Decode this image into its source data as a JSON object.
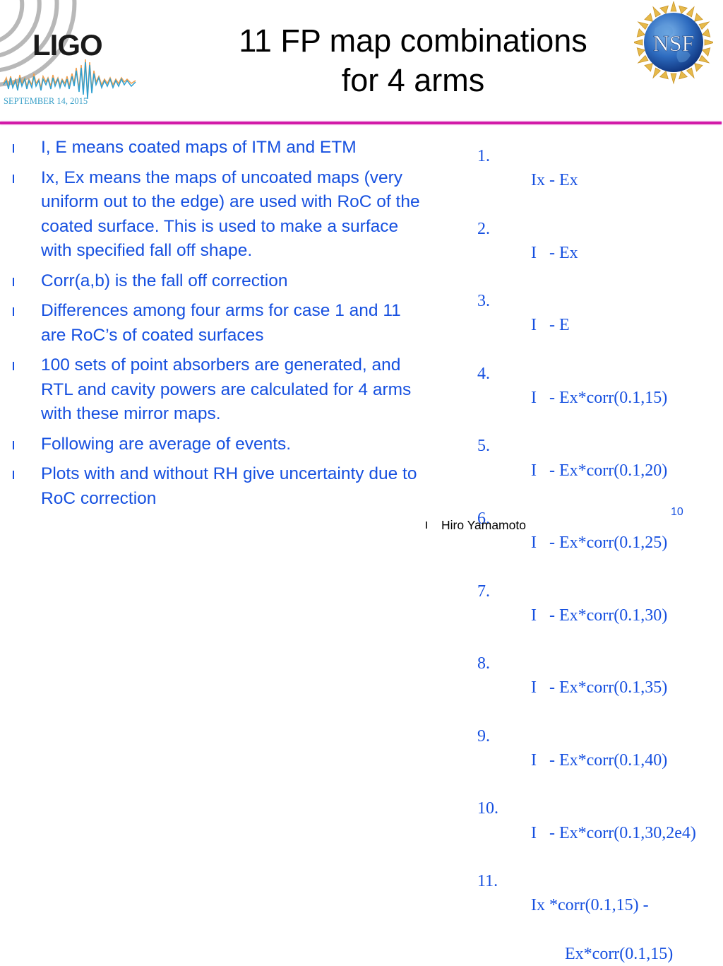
{
  "header": {
    "title_line1": "11 FP map combinations",
    "title_line2": "for 4 arms",
    "left_logo": {
      "icon": "ligo-logo",
      "wordmark": "LIGO",
      "caption": "SEPTEMBER 14, 2015"
    },
    "right_logo": {
      "icon": "nsf-logo",
      "wordmark": "NSF"
    },
    "divider_color": "#d21aa8"
  },
  "bullets": [
    {
      "text": "I, E means coated maps of ITM and ETM"
    },
    {
      "text": "Ix, Ex means the maps of uncoated maps (very uniform out to the edge) are used with RoC of the coated surface. This is used to make a surface with specified fall off shape."
    },
    {
      "text": "Corr(a,b) is the fall off correction"
    },
    {
      "text": "Differences among four arms for case 1 and 11 are RoC’s of coated surfaces"
    },
    {
      "text": "100 sets of point absorbers are generated, and RTL and cavity powers are calculated for 4 arms with these mirror maps."
    },
    {
      "text": "Following are average of events."
    },
    {
      "text": "Plots with and without RH give uncertainty due to RoC correction"
    }
  ],
  "combinations": [
    {
      "num": "1.",
      "text": "Ix - Ex"
    },
    {
      "num": "2.",
      "text": "I   - Ex"
    },
    {
      "num": "3.",
      "text": "I   - E"
    },
    {
      "num": "4.",
      "text": "I   - Ex*corr(0.1,15)"
    },
    {
      "num": "5.",
      "text": "I   - Ex*corr(0.1,20)"
    },
    {
      "num": "6.",
      "text": "I   - Ex*corr(0.1,25)"
    },
    {
      "num": "7.",
      "text": "I   - Ex*corr(0.1,30)"
    },
    {
      "num": "8.",
      "text": "I   - Ex*corr(0.1,35)"
    },
    {
      "num": "9.",
      "text": "I   - Ex*corr(0.1,40)"
    },
    {
      "num": "10.",
      "text": "I   - Ex*corr(0.1,30,2e4)"
    },
    {
      "num": "11.",
      "text": "Ix *corr(0.1,15) -",
      "continuation": "Ex*corr(0.1,15)"
    }
  ],
  "footer": {
    "author": "Hiro Yamamoto",
    "page_number": "10"
  },
  "colors": {
    "body_text": "#1650e0",
    "title_text": "#000000",
    "accent_line": "#d21aa8"
  }
}
